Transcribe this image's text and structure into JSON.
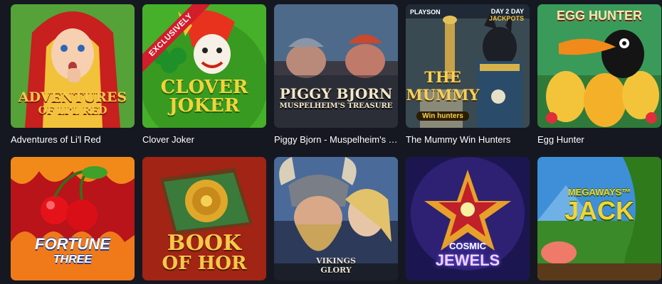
{
  "games": [
    {
      "title": "Adventures of Li'l Red",
      "logo_line1": "ADVENTURES",
      "logo_line2": "OF LI'L RED"
    },
    {
      "title": "Clover Joker",
      "logo_line1": "CLOVER",
      "logo_line2": "JOKER",
      "badge": "EXCLUSIVELY"
    },
    {
      "title": "Piggy Bjorn - Muspelheim's Treasure",
      "logo_line1": "PIGGY BJORN",
      "logo_line2": "MUSPELHEIM'S TREASURE"
    },
    {
      "title": "The Mummy Win Hunters",
      "logo_line1": "THE MUMMY",
      "logo_line2": "Win hunters",
      "provider": "PLAYSON",
      "promo_line1": "DAY 2 DAY",
      "promo_line2": "JACKPOTS"
    },
    {
      "title": "Egg Hunter",
      "logo_line1": "EGG HUNTER"
    },
    {
      "title": "Fortune Three",
      "logo_line1": "FORTUNE",
      "logo_line2": "THREE"
    },
    {
      "title": "Book of Hor",
      "logo_line1": "BOOK",
      "logo_line2": "OF HOR"
    },
    {
      "title": "Vikings Glory",
      "logo_line1": "VIKINGS",
      "logo_line2": "GLORY"
    },
    {
      "title": "Cosmic Jewels",
      "logo_line1": "COSMIC",
      "logo_line2": "JEWELS"
    },
    {
      "title": "Megaways Jack",
      "logo_line1": "MEGAWAYS™",
      "logo_line2": "JACK"
    }
  ]
}
